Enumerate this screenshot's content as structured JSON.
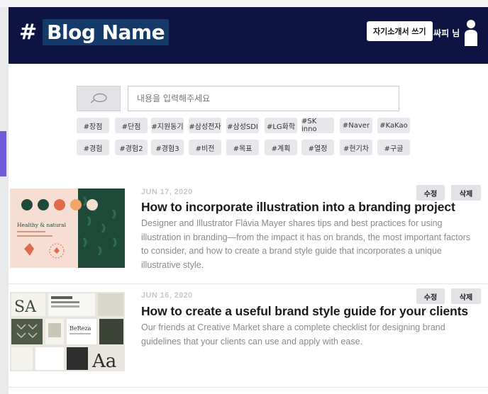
{
  "header": {
    "blog_name": "Blog Name",
    "hash_symbol": "#",
    "write_intro_label": "자기소개서 쓰기",
    "user_name": "김싸피 님",
    "colors": {
      "header_bg": "#0d1442",
      "name_highlight": "#133a68"
    }
  },
  "search": {
    "placeholder": "내용을 입력해주세요",
    "icon": "search-icon"
  },
  "tags": {
    "row1": [
      "#장점",
      "#단점",
      "#지원동기",
      "#삼성전자",
      "#삼성SDI",
      "#LG화학",
      "#SK inno",
      "#Naver",
      "#KaKao"
    ],
    "row2": [
      "#경험",
      "#경험2",
      "#경험3",
      "#비전",
      "#목표",
      "#계획",
      "#열정",
      "#현기차",
      "#구글"
    ]
  },
  "posts": [
    {
      "date": "JUN 17, 2020",
      "title": "How to incorporate illustration into a branding project",
      "description": "Designer and Illustrator Flávia Mayer shares tips and best practices for using illustration in branding—from the impact it has on brands, the most important factors to consider, and how to create a brand style guide that incorporates a unique illustrative style.",
      "edit_label": "수정",
      "delete_label": "삭제",
      "thumb_text": "Healthy & natural"
    },
    {
      "date": "JUN 16, 2020",
      "title": "How to create a useful brand style guide for your clients",
      "description": "Our friends at Creative Market share a complete checklist for designing brand guidelines that your clients can use and apply with ease.",
      "edit_label": "수정",
      "delete_label": "삭제",
      "thumb_text": "BeReza"
    }
  ]
}
